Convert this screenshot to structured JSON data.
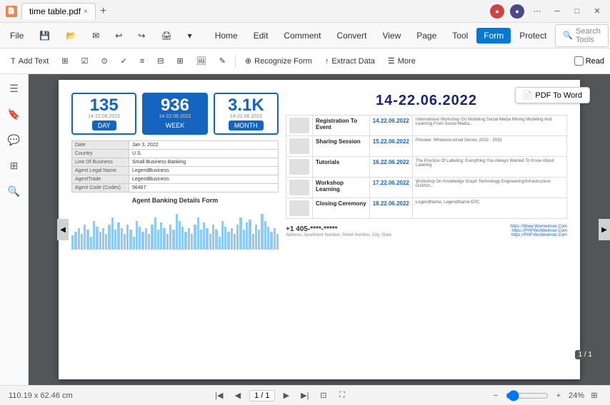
{
  "titlebar": {
    "icon": "📄",
    "filename": "time table.pdf",
    "close_tab": "×",
    "add_tab": "+"
  },
  "menu": {
    "file": "File",
    "save": "💾",
    "items": [
      "Home",
      "Edit",
      "Comment",
      "Convert",
      "View",
      "Page",
      "Tool",
      "Form",
      "Protect"
    ],
    "active": "Form",
    "search_placeholder": "Search Tools"
  },
  "toolbar": {
    "add_text": "Add Text",
    "recognize_form": "Recognize Form",
    "extract_data": "Extract Data",
    "more": "More",
    "read": "Read"
  },
  "document": {
    "stats": [
      {
        "number": "135",
        "date": "14-22.06.2022",
        "label": "DAY"
      },
      {
        "number": "936",
        "date": "14-22.06.2022",
        "label": "WEEK"
      },
      {
        "number": "3.1K",
        "date": "14-22.06.2022",
        "label": "MONTH"
      }
    ],
    "big_date": "14-22.06.2022",
    "form_fields": [
      {
        "label": "Date",
        "value": "Jan 3, 2022"
      },
      {
        "label": "Country",
        "value": "U.S."
      },
      {
        "label": "Line Of Business",
        "value": "Small Business Banking"
      },
      {
        "label": "Agent Legal Name",
        "value": "LegendBusiness"
      },
      {
        "label": "AgentTrade",
        "value": "LegendBusiness"
      },
      {
        "label": "Agent Code (Codes)",
        "value": "56467"
      }
    ],
    "chart_title": "Agent Banking Details Form",
    "schedule": [
      {
        "event": "Registration To Event",
        "date": "14.22.06.2022",
        "desc": "International Workshop On Modeling Social Media Mining Modeling And Learning From Social Media..."
      },
      {
        "event": "Sharing Session",
        "date": "15.22.06.2022",
        "desc": "Preview: Wherever.email Server, 2032 - 3033"
      },
      {
        "event": "Tutorials",
        "date": "16.22.06.2022",
        "desc": "The Practice Of Labeling: Everything You Always Wanted To Know About Labeling"
      },
      {
        "event": "Workshop Learning",
        "date": "17.22.06.2022",
        "desc": "Workshop On Knowledge Graph Technology Engineering/Infrastructure Distinct Distinct, Wherever, Distinct"
      },
      {
        "event": "Closing Ceremony",
        "date": "18.22.06.2022",
        "desc": "LegendName, LegendName-EPC"
      }
    ],
    "phone": "+1 405-****-*****",
    "address": "Address: Apartment Number, Street Number, City, State",
    "links": [
      "https://Www.Wornwinner.Com",
      "https://PHPWorldwinner.Com",
      "https://PHP.Worldwinner.Com"
    ]
  },
  "statusbar": {
    "dimensions": "110.19 x 62.46 cm",
    "page": "1 / 1",
    "zoom": "24%"
  }
}
